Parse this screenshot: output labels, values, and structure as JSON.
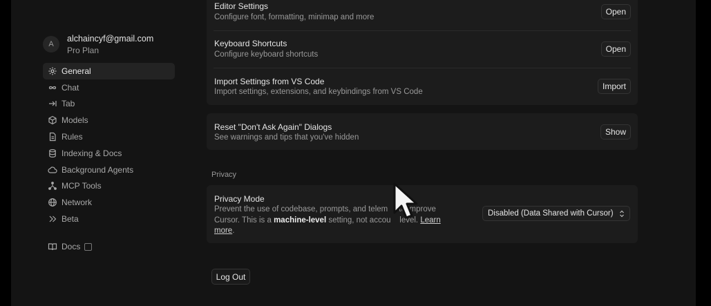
{
  "account": {
    "avatar_initial": "A",
    "email": "alchaincyf@gmail.com",
    "plan": "Pro Plan"
  },
  "nav": {
    "items": [
      {
        "label": "General",
        "icon": "gear-icon",
        "active": true
      },
      {
        "label": "Chat",
        "icon": "infinity-icon"
      },
      {
        "label": "Tab",
        "icon": "tab-arrow-icon"
      },
      {
        "label": "Models",
        "icon": "cube-icon"
      },
      {
        "label": "Rules",
        "icon": "file-icon"
      },
      {
        "label": "Indexing & Docs",
        "icon": "database-icon"
      },
      {
        "label": "Background Agents",
        "icon": "cloud-icon"
      },
      {
        "label": "MCP Tools",
        "icon": "nodes-icon"
      },
      {
        "label": "Network",
        "icon": "globe-icon"
      },
      {
        "label": "Beta",
        "icon": "chevrons-right-icon"
      }
    ],
    "docs_label": "Docs",
    "docs_icon": "book-icon"
  },
  "settings": {
    "editor": {
      "title": "Editor Settings",
      "desc": "Configure font, formatting, minimap and more",
      "button": "Open"
    },
    "keyboard": {
      "title": "Keyboard Shortcuts",
      "desc": "Configure keyboard shortcuts",
      "button": "Open"
    },
    "import": {
      "title": "Import Settings from VS Code",
      "desc": "Import settings, extensions, and keybindings from VS Code",
      "button": "Import"
    },
    "reset": {
      "title": "Reset \"Don't Ask Again\" Dialogs",
      "desc": "See warnings and tips that you've hidden",
      "button": "Show"
    }
  },
  "privacy": {
    "section_label": "Privacy",
    "title": "Privacy Mode",
    "desc_part1": "Prevent the use of codebase, prompts, and telem",
    "desc_part2": "to improve Cursor. This is a ",
    "desc_bold": "machine-level",
    "desc_part3": " setting, not accou",
    "desc_part4": "level. ",
    "learn_more": "Learn more",
    "select_value": "Disabled (Data Shared with Cursor)"
  },
  "logout_label": "Log Out",
  "colors": {
    "background": "#141414",
    "card": "#1c1c1c",
    "active_nav": "#232323"
  }
}
